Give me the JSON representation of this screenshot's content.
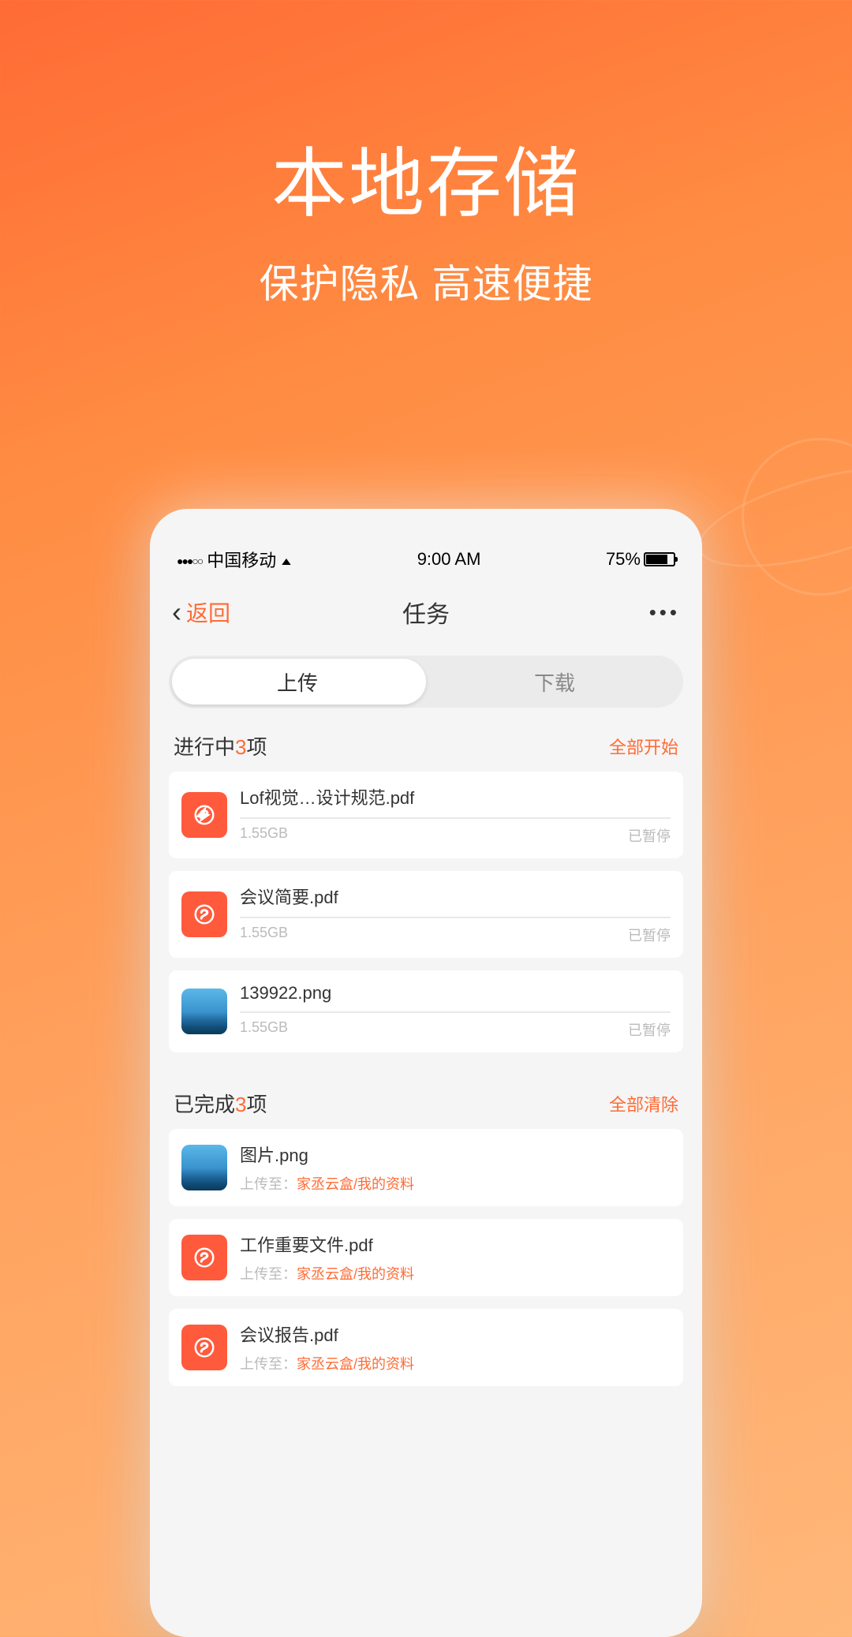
{
  "hero": {
    "title": "本地存储",
    "subtitle": "保护隐私 高速便捷"
  },
  "status": {
    "carrier": "中国移动",
    "time": "9:00 AM",
    "battery_pct": "75%"
  },
  "nav": {
    "back": "返回",
    "title": "任务",
    "more": "•••"
  },
  "tabs": {
    "upload": "上传",
    "download": "下载"
  },
  "in_progress": {
    "title_pre": "进行中",
    "count": "3",
    "title_post": "项",
    "action": "全部开始",
    "items": [
      {
        "name": "Lof视觉…设计规范.pdf",
        "size": "1.55GB",
        "status": "已暂停",
        "type": "pdf"
      },
      {
        "name": "会议简要.pdf",
        "size": "1.55GB",
        "status": "已暂停",
        "type": "pdf"
      },
      {
        "name": "139922.png",
        "size": "1.55GB",
        "status": "已暂停",
        "type": "img"
      }
    ]
  },
  "completed": {
    "title_pre": "已完成",
    "count": "3",
    "title_post": "项",
    "action": "全部清除",
    "upload_prefix": "上传至：",
    "items": [
      {
        "name": "图片.png",
        "path": "家丞云盒/我的资料",
        "type": "img"
      },
      {
        "name": "工作重要文件.pdf",
        "path": "家丞云盒/我的资料",
        "type": "pdf"
      },
      {
        "name": "会议报告.pdf",
        "path": "家丞云盒/我的资料",
        "type": "pdf"
      }
    ]
  }
}
